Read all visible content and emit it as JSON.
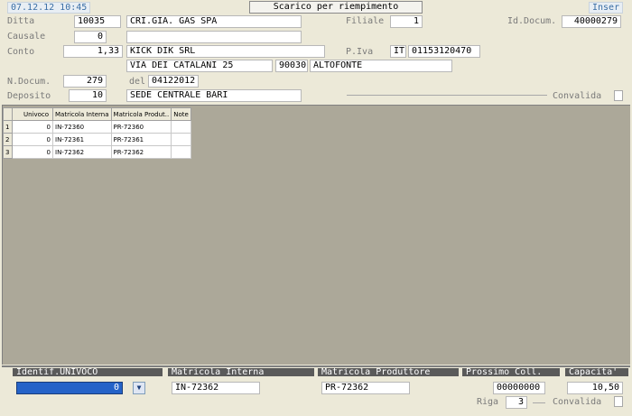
{
  "header": {
    "datetime": "07.12.12 10:45",
    "title": "Scarico per riempimento",
    "mode": "Inser"
  },
  "form": {
    "ditta": {
      "label": "Ditta",
      "code": "10035",
      "name": "CRI.GIA. GAS SPA"
    },
    "filiale": {
      "label": "Filiale",
      "value": "1"
    },
    "id_docum": {
      "label": "Id.Docum.",
      "value": "40000279"
    },
    "causale": {
      "label": "Causale",
      "code": "0",
      "desc": ""
    },
    "conto": {
      "label": "Conto",
      "code": "1,33",
      "name": "KICK DIK SRL"
    },
    "piva": {
      "label": "P.Iva",
      "country": "IT",
      "value": "01153120470"
    },
    "address": {
      "street": "VIA DEI CATALANI 25",
      "cap": "90030",
      "city": "ALTOFONTE"
    },
    "ndocum": {
      "label": "N.Docum.",
      "value": "279"
    },
    "del": {
      "label": "del",
      "value": "04122012"
    },
    "deposito": {
      "label": "Deposito",
      "code": "10",
      "name": "SEDE CENTRALE BARI"
    },
    "convalida_label": "Convalida"
  },
  "grid": {
    "columns": [
      "Univoco",
      "Matricola Interna",
      "Matricola Produt..",
      "Note"
    ],
    "rows": [
      {
        "n": "1",
        "univoco": "0",
        "interna": "IN-72360",
        "produttore": "PR-72360",
        "note": ""
      },
      {
        "n": "2",
        "univoco": "0",
        "interna": "IN-72361",
        "produttore": "PR-72361",
        "note": ""
      },
      {
        "n": "3",
        "univoco": "0",
        "interna": "IN-72362",
        "produttore": "PR-72362",
        "note": ""
      }
    ]
  },
  "bottom": {
    "identif_label": "Identif.UNIVOCO",
    "identif_value": "0",
    "interna_label": "Matricola Interna",
    "interna_value": "IN-72362",
    "produttore_label": "Matricola Produttore",
    "produttore_value": "PR-72362",
    "prossimo_label": "Prossimo Coll.",
    "prossimo_value": "00000000",
    "capacita_label": "Capacita'",
    "capacita_value": "10,50",
    "riga_label": "Riga",
    "riga_value": "3",
    "convalida_label": "Convalida"
  }
}
